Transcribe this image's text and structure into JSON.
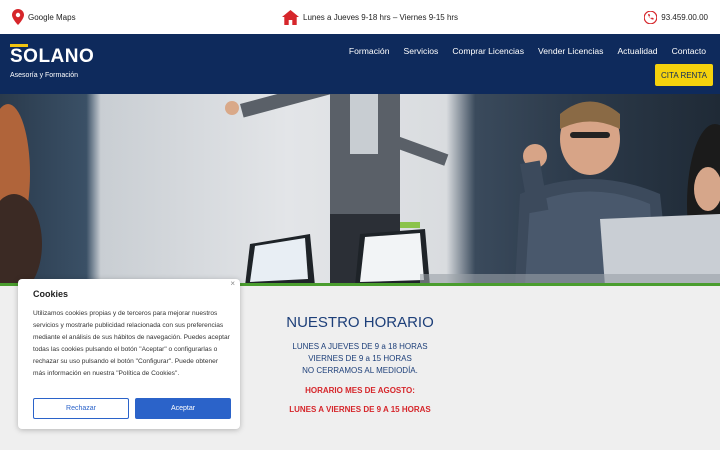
{
  "topbar": {
    "maps": {
      "label": "Google Maps",
      "icon": "map-pin-icon"
    },
    "hours": {
      "label": "Lunes a Jueves 9-18 hrs – Viernes 9-15 hrs",
      "icon": "home-icon"
    },
    "phone": {
      "label": "93.459.00.00",
      "icon": "phone-icon"
    }
  },
  "logo": {
    "name": "SOLANO",
    "tagline": "Asesoría y Formación"
  },
  "menu": [
    "Formación",
    "Servicios",
    "Comprar Licencias",
    "Vender Licencias",
    "Actualidad",
    "Contacto"
  ],
  "cta": {
    "label": "CITA RENTA"
  },
  "schedule": {
    "title": "NUESTRO HORARIO",
    "lines": [
      "LUNES A JUEVES DE 9 a 18 HORAS",
      "VIERNES DE  9 a 15 HORAS",
      "NO CERRAMOS AL MEDIODÍA."
    ],
    "august_title": "HORARIO MES DE AGOSTO:",
    "august_line": "LUNES A VIERNES DE 9 A 15 HORAS"
  },
  "cookies": {
    "close": "×",
    "title": "Cookies",
    "text": "Utilizamos cookies propias y de terceros para mejorar nuestros servicios y mostrarle publicidad relacionada con sus preferencias mediante el análisis de sus hábitos de navegación. Puedes aceptar todas las cookies pulsando el botón \"Aceptar\" o configurarlas o rechazar su uso pulsando el botón \"Configurar\". Puede obtener más información en nuestra \"Política de Cookies\".",
    "reject_label": "Rechazar",
    "accept_label": "Aceptar"
  },
  "colors": {
    "navy": "#0e2a5c",
    "yellow": "#f5d20c",
    "red": "#d6262b",
    "blue_button": "#2b63c9",
    "green_strip": "#4a9d2e"
  }
}
